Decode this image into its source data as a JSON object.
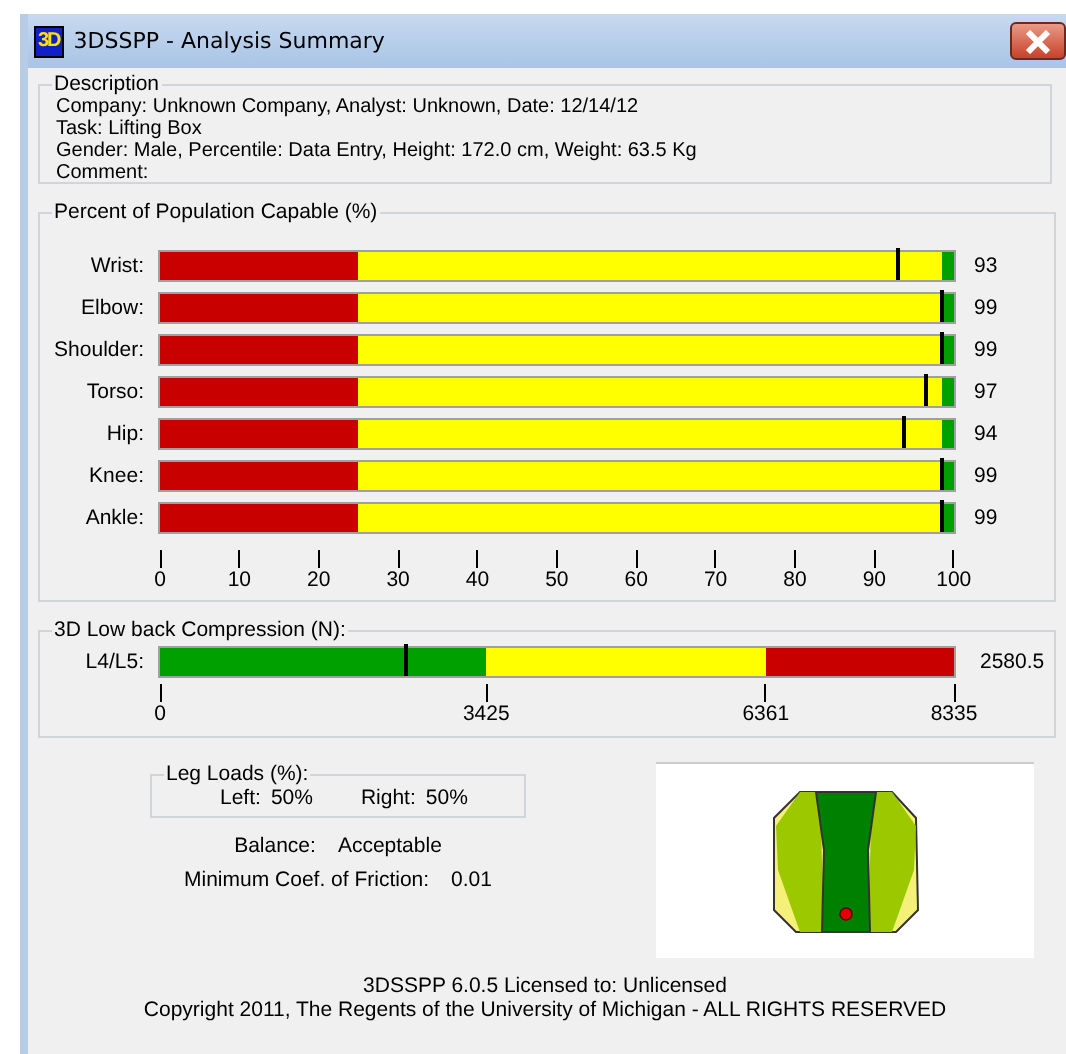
{
  "window": {
    "icon_text": "3D",
    "title": "3DSSPP - Analysis Summary"
  },
  "description": {
    "legend": "Description",
    "lines": [
      "Company: Unknown Company, Analyst: Unknown, Date: 12/14/12",
      "Task: Lifting Box",
      "Gender: Male, Percentile: Data Entry, Height: 172.0 cm, Weight: 63.5 Kg",
      "Comment:"
    ]
  },
  "population": {
    "legend": "Percent of Population Capable (%)",
    "zones": [
      {
        "color": "#c80000"
      },
      {
        "color": "#ffff00"
      },
      {
        "color": "#00a000"
      }
    ],
    "rows": [
      {
        "label": "Wrist:",
        "level": 0.93,
        "reading": "93"
      },
      {
        "label": "Elbow:",
        "level": 0.985,
        "reading": "99"
      },
      {
        "label": "Shoulder:",
        "level": 0.985,
        "reading": "99"
      },
      {
        "label": "Torso:",
        "level": 0.965,
        "reading": "97"
      },
      {
        "label": "Hip:",
        "level": 0.938,
        "reading": "94"
      },
      {
        "label": "Knee:",
        "level": 0.985,
        "reading": "99"
      },
      {
        "label": "Ankle:",
        "level": 0.985,
        "reading": "99"
      }
    ],
    "ticks": [
      "0",
      "10",
      "20",
      "30",
      "40",
      "50",
      "60",
      "70",
      "80",
      "90",
      "100"
    ]
  },
  "compression": {
    "legend": "3D Low back Compression (N):",
    "label": "L4/L5:",
    "level": 0.31,
    "reading": "2580.5",
    "zones": [
      {
        "color": "#00a000"
      },
      {
        "color": "#ffff00"
      },
      {
        "color": "#c80000"
      }
    ],
    "ticks": [
      "0",
      "3425",
      "6361",
      "8335"
    ]
  },
  "leg_loads": {
    "legend": "Leg Loads (%):",
    "left_label": "Left:",
    "left_value": "50%",
    "right_label": "Right:",
    "right_value": "50%"
  },
  "balance": {
    "label": "Balance:",
    "value": "Acceptable"
  },
  "friction": {
    "label": "Minimum Coef. of Friction:",
    "value": "0.01"
  },
  "footer": [
    "3DSSPP 6.0.5 Licensed to: Unlicensed",
    "Copyright 2011, The Regents of the University of Michigan - ALL RIGHTS RESERVED"
  ]
}
